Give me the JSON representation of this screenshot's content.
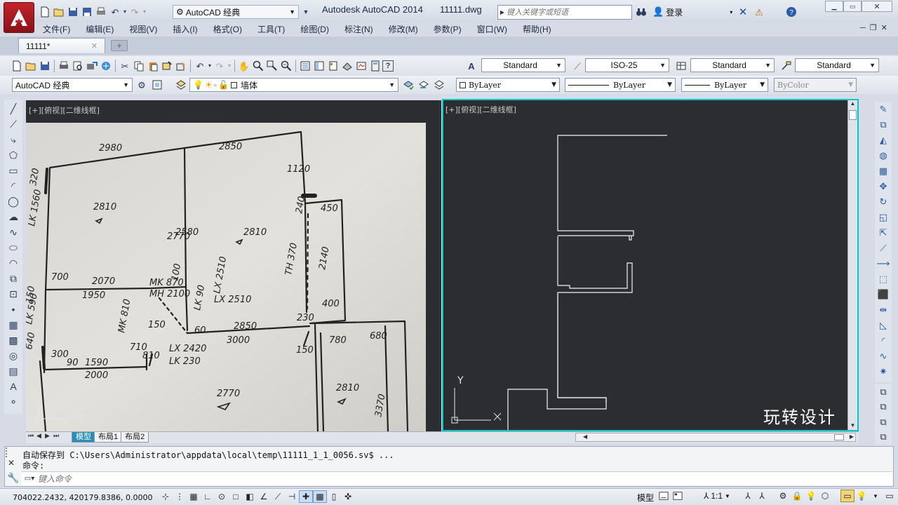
{
  "titlebar": {
    "workspace": "AutoCAD 经典",
    "app_title": "Autodesk AutoCAD 2014",
    "file_name": "11111.dwg",
    "search_placeholder": "键入关键字或短语",
    "login_label": "登录"
  },
  "menu": [
    "文件(F)",
    "编辑(E)",
    "视图(V)",
    "插入(I)",
    "格式(O)",
    "工具(T)",
    "绘图(D)",
    "标注(N)",
    "修改(M)",
    "参数(P)",
    "窗口(W)",
    "帮助(H)"
  ],
  "doc_tab": {
    "label": "11111*"
  },
  "styles": {
    "text_style": "Standard",
    "dim_style": "ISO-25",
    "table_style": "Standard",
    "multileader_style": "Standard"
  },
  "layers": {
    "workspace": "AutoCAD 经典",
    "current_layer": "墙体",
    "color": "ByLayer",
    "linetype": "ByLayer",
    "lineweight": "ByLayer",
    "plotstyle": "ByColor"
  },
  "viewports": {
    "left_label": "[+][俯视][二维线框]",
    "right_label": "[+][俯视][二维线框]"
  },
  "layout_tabs": [
    "模型",
    "布局1",
    "布局2"
  ],
  "command": {
    "history_line": "自动保存到 C:\\Users\\Administrator\\appdata\\local\\temp\\11111_1_1_0056.sv$ ...",
    "prompt_line": "命令:",
    "input_placeholder": "键入命令"
  },
  "status": {
    "coordinates": "704022.2432, 420179.8386, 0.0000",
    "model_label": "模型",
    "scale": "1:1"
  },
  "watermark": "玩转设计",
  "sketch_labels": [
    "2980",
    "2850",
    "1120",
    "2810",
    "2770",
    "2580",
    "2810",
    "320",
    "LK 1560",
    "240",
    "450",
    "2140",
    "TH 370",
    "MK 870",
    "MH 2100",
    "2070",
    "1950",
    "100",
    "LX 2510",
    "LK 90",
    "MK 810",
    "150",
    "60",
    "2850",
    "3000",
    "230",
    "700",
    "1590",
    "300",
    "90",
    "2000",
    "710",
    "810",
    "LX 2420",
    "LK 230",
    "LX 2510",
    "780",
    "680",
    "2810",
    "2770",
    "3370",
    "150",
    "640",
    "LK 590",
    "150",
    "400"
  ],
  "accent": "#00c8c8"
}
